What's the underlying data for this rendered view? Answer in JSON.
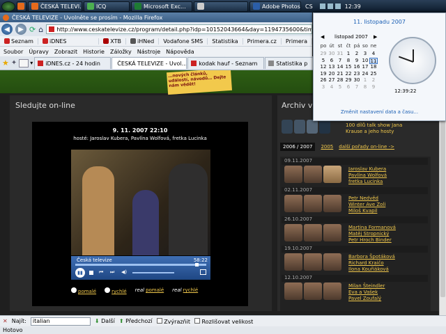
{
  "taskbar": {
    "buttons": [
      {
        "label": ""
      },
      {
        "label": "ČESKÁ TELEVI..."
      },
      {
        "label": "ICQ"
      },
      {
        "label": "Microsoft Exc..."
      },
      {
        "label": ""
      },
      {
        "label": "Adobe Photos..."
      }
    ],
    "lang": "CS",
    "clock": "12:39"
  },
  "window": {
    "title": "ČESKÁ TELEVIZE - Uvolněte se prosím - Mozilla Firefox",
    "url": "http://www.ceskatelevize.cz/program/detail.php?idp=10152043664&day=1194735600&time=01:50&ch=28"
  },
  "bookmarks": [
    "Seznam",
    "iDNES",
    "XTB",
    "iHNed",
    "Vodafone SMS",
    "Statistika",
    "Primera.cz",
    "Primera"
  ],
  "menu": [
    "Soubor",
    "Úpravy",
    "Zobrazit",
    "Historie",
    "Záložky",
    "Nástroje",
    "Nápověda"
  ],
  "tabs": [
    {
      "label": "iDNES.cz - 24 hodin",
      "active": false
    },
    {
      "label": "ČESKÁ TELEVIZE - Uvol...",
      "active": true
    },
    {
      "label": "kodak hauf - Seznam",
      "active": false
    },
    {
      "label": "Statistika p",
      "active": false
    }
  ],
  "banner": {
    "note": "…nových článků, událostí, návodů… Dejte nám vědět!"
  },
  "left": {
    "heading": "Sledujte on-line",
    "date_time": "9. 11. 2007 22:10",
    "guests": "hosté: Jaroslav Kubera, Pavlína Wolfová, fretka Lucinka",
    "player": {
      "channel": "Česká televize",
      "time": "58:22"
    },
    "speeds": [
      "pomalé",
      "rychlé",
      "pomalé",
      "rychlé"
    ],
    "real": "real"
  },
  "right": {
    "heading": "Archiv v",
    "intro": [
      "100 dílů talk show Jana",
      "Krause a jeho hosty"
    ],
    "intro_top": "...",
    "tabs": [
      "2006 / 2007",
      "2005",
      "další pořady on-line ->"
    ],
    "entries": [
      {
        "date": "09.11.2007",
        "names": [
          "Jaroslav Kubera",
          "Pavlína Wolfová",
          "fretka Lucinka"
        ]
      },
      {
        "date": "02.11.2007",
        "names": [
          "Petr Nedvěd",
          "Winter Ave Zoli",
          "Miloš Kvapil"
        ]
      },
      {
        "date": "26.10.2007",
        "names": [
          "Martina Formanová",
          "Matěj Stropnický",
          "Petr Hroch Binder"
        ]
      },
      {
        "date": "19.10.2007",
        "names": [
          "Barbora Špotáková",
          "Richard Kraičo",
          "Ilona Kouřiáková"
        ]
      },
      {
        "date": "12.10.2007",
        "names": [
          "Milan Šteindler",
          "Eva a Vašek",
          "Pavel Zoufalý"
        ]
      }
    ]
  },
  "calendar": {
    "header_date": "11. listopadu 2007",
    "month": "listopad 2007",
    "days_head": [
      "po",
      "út",
      "st",
      "čt",
      "pá",
      "so",
      "ne"
    ],
    "weeks": [
      [
        "29",
        "30",
        "31",
        "1",
        "2",
        "3",
        "4"
      ],
      [
        "5",
        "6",
        "7",
        "8",
        "9",
        "10",
        "11"
      ],
      [
        "12",
        "13",
        "14",
        "15",
        "16",
        "17",
        "18"
      ],
      [
        "19",
        "20",
        "21",
        "22",
        "23",
        "24",
        "25"
      ],
      [
        "26",
        "27",
        "28",
        "29",
        "30",
        "1",
        "2"
      ],
      [
        "3",
        "4",
        "5",
        "6",
        "7",
        "8",
        "9"
      ]
    ],
    "selected": "11",
    "time": "12:39:22",
    "link": "Změnit nastavení data a času..."
  },
  "findbar": {
    "label": "Najít:",
    "value": "italian",
    "next": "Další",
    "prev": "Předchozí",
    "highlight": "Zvýrazňit",
    "case": "Rozlišovat velikost"
  },
  "status": "Hotovo",
  "colors": {
    "accent_green": "#2e5e14",
    "link_gold": "#f2c94c",
    "page_bg": "#1f1f1f"
  }
}
